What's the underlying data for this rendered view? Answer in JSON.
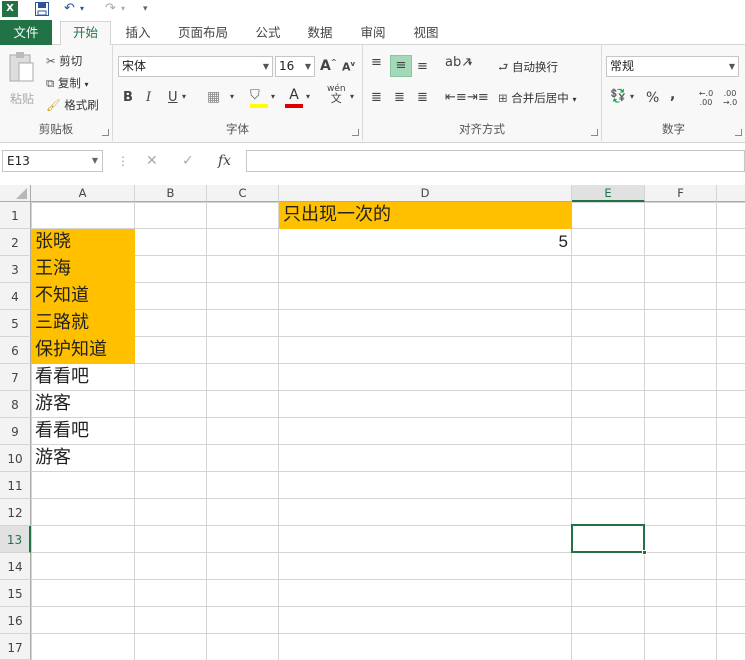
{
  "app": {
    "logo": "X"
  },
  "qat": {
    "undo_icon": "↶",
    "redo_icon": "↷",
    "more": "▾"
  },
  "tabs": [
    "文件",
    "开始",
    "插入",
    "页面布局",
    "公式",
    "数据",
    "审阅",
    "视图"
  ],
  "ribbon": {
    "clipboard": {
      "label": "剪贴板",
      "paste": "粘贴",
      "cut": "剪切",
      "copy": "复制",
      "format_painter": "格式刷"
    },
    "font": {
      "label": "字体",
      "name": "宋体",
      "size": "16",
      "bold": "B",
      "italic": "I",
      "underline": "U",
      "grow": "A",
      "shrink": "A",
      "font_color_letter": "A",
      "phonetic": "wén"
    },
    "align": {
      "label": "对齐方式",
      "wrap": "自动换行",
      "merge": "合并后居中"
    },
    "number": {
      "label": "数字",
      "format": "常规",
      "percent": "%",
      "comma": ",",
      "inc_dec": "←.0 .00",
      "dec_dec": ".00 →.0"
    }
  },
  "formula_bar": {
    "name_box": "E13",
    "cancel": "✕",
    "enter": "✓",
    "fx": "fx",
    "formula": ""
  },
  "columns": [
    "A",
    "B",
    "C",
    "D",
    "E",
    "F"
  ],
  "rows": [
    "1",
    "2",
    "3",
    "4",
    "5",
    "6",
    "7",
    "8",
    "9",
    "10",
    "11",
    "12",
    "13",
    "14",
    "15",
    "16",
    "17"
  ],
  "cells": {
    "D1": "只出现一次的",
    "D2": "5",
    "A2": "张晓",
    "A3": "王海",
    "A4": "不知道",
    "A5": "三路就",
    "A6": "保护知道",
    "A7": "看看吧",
    "A8": "游客",
    "A9": "看看吧",
    "A10": "游客"
  },
  "colors": {
    "accent": "#217346",
    "highlight": "#ffc000"
  }
}
